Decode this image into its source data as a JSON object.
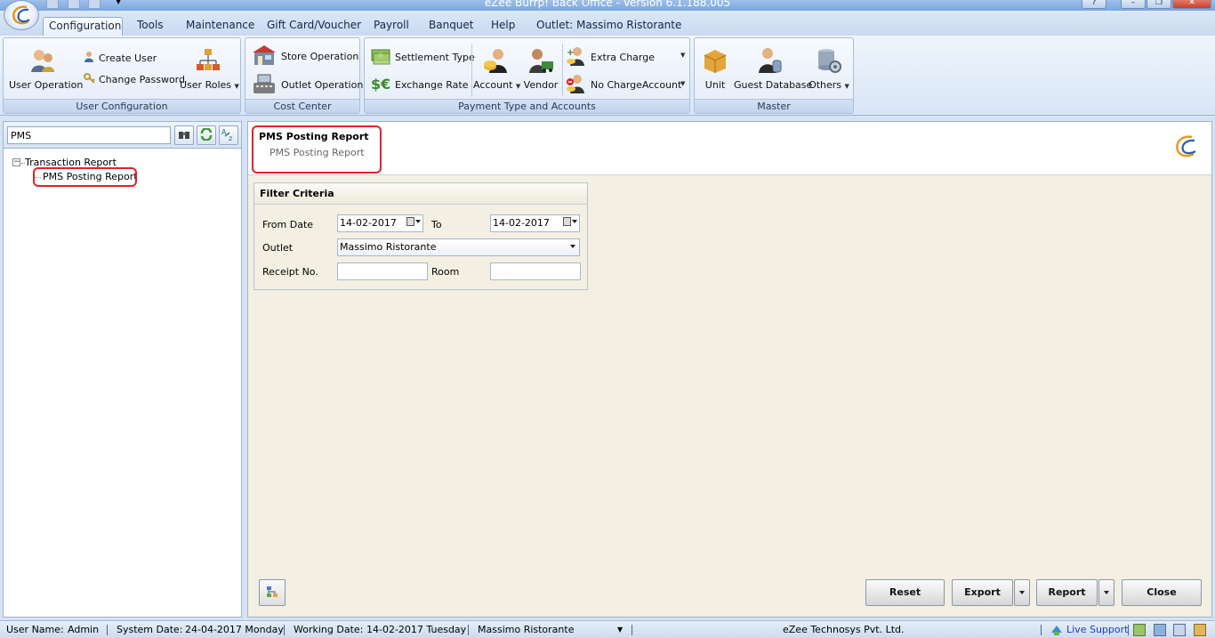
{
  "window": {
    "title": "eZee Burrp! Back Office - Version 6.1.188.005"
  },
  "tabs": [
    {
      "label": "Configuration",
      "active": true
    },
    {
      "label": "Tools"
    },
    {
      "label": "Maintenance"
    },
    {
      "label": "Gift Card/Voucher"
    },
    {
      "label": "Payroll"
    },
    {
      "label": "Banquet"
    },
    {
      "label": "Help"
    },
    {
      "label": "Outlet: Massimo Ristorante"
    }
  ],
  "ribbon": {
    "user_configuration": {
      "label": "User Configuration",
      "user_operation": "User Operation",
      "create_user": "Create User",
      "change_password": "Change Password",
      "user_roles": "User Roles"
    },
    "cost_center": {
      "label": "Cost Center",
      "store_operation": "Store Operation",
      "outlet_operation": "Outlet Operation"
    },
    "payment": {
      "label": "Payment Type and Accounts",
      "settlement_type": "Settlement Type",
      "exchange_rate": "Exchange Rate",
      "account": "Account",
      "vendor": "Vendor",
      "extra_charge": "Extra Charge",
      "no_charge_account": "No ChargeAccount"
    },
    "master": {
      "label": "Master",
      "unit": "Unit",
      "guest_database": "Guest Database",
      "others": "Others"
    }
  },
  "left_panel": {
    "search_value": "PMS",
    "tree": {
      "root": "Transaction Report",
      "child": "PMS Posting Report"
    }
  },
  "main": {
    "header_title": "PMS Posting Report",
    "header_subtitle": "PMS Posting Report",
    "filter": {
      "title": "Filter Criteria",
      "from_date_label": "From Date",
      "from_date": "14-02-2017",
      "to_label": "To",
      "to_date": "14-02-2017",
      "outlet_label": "Outlet",
      "outlet_value": "Massimo Ristorante",
      "receipt_label": "Receipt No.",
      "receipt_value": "",
      "room_label": "Room",
      "room_value": ""
    },
    "buttons": {
      "reset": "Reset",
      "export": "Export",
      "report": "Report",
      "close": "Close"
    }
  },
  "status": {
    "user_label": "User Name:",
    "user": "Admin",
    "system_date_label": "System Date:",
    "system_date": "24-04-2017 Monday",
    "working_date_label": "Working Date:",
    "working_date": "14-02-2017 Tuesday",
    "outlet": "Massimo Ristorante",
    "company": "eZee Technosys Pvt. Ltd.",
    "live_support": "Live Support"
  }
}
